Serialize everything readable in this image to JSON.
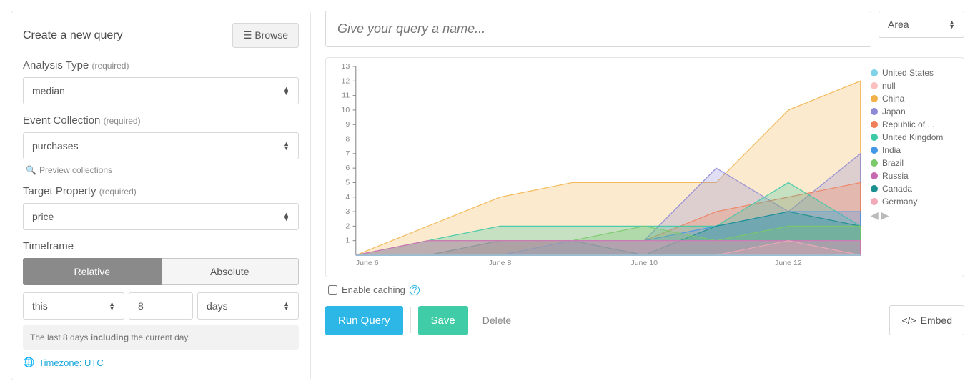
{
  "left": {
    "title": "Create a new query",
    "browse_label": "Browse",
    "analysis_label": "Analysis Type",
    "required": "(required)",
    "analysis_value": "median",
    "event_label": "Event Collection",
    "event_value": "purchases",
    "preview_label": "Preview collections",
    "target_label": "Target Property",
    "target_value": "price",
    "timeframe_label": "Timeframe",
    "tab_relative": "Relative",
    "tab_absolute": "Absolute",
    "rel_qualifier": "this",
    "rel_amount": "8",
    "rel_unit": "days",
    "tf_desc_pre": "The last 8 days ",
    "tf_desc_bold": "including",
    "tf_desc_post": " the current day.",
    "tz_label": "Timezone: UTC"
  },
  "right": {
    "query_name_placeholder": "Give your query a name...",
    "chart_type": "Area",
    "enable_caching": "Enable caching",
    "run_query": "Run Query",
    "save": "Save",
    "delete": "Delete",
    "embed": "Embed"
  },
  "legend": [
    {
      "name": "United States",
      "color": "#7fd3e8"
    },
    {
      "name": "null",
      "color": "#fcbfc1"
    },
    {
      "name": "China",
      "color": "#f2b24a"
    },
    {
      "name": "Japan",
      "color": "#8e8ad6"
    },
    {
      "name": "Republic of ...",
      "color": "#f07e5a"
    },
    {
      "name": "United Kingdom",
      "color": "#3bc9a6"
    },
    {
      "name": "India",
      "color": "#4496e8"
    },
    {
      "name": "Brazil",
      "color": "#7ac96b"
    },
    {
      "name": "Russia",
      "color": "#c66bb3"
    },
    {
      "name": "Canada",
      "color": "#1a8f8f"
    },
    {
      "name": "Germany",
      "color": "#f2a9b8"
    }
  ],
  "chart_data": {
    "type": "area",
    "x": [
      "June 6",
      "June 7",
      "June 8",
      "June 9",
      "June 10",
      "June 11",
      "June 12",
      "June 13"
    ],
    "ylim": [
      0,
      13
    ],
    "yticks": [
      1,
      2,
      3,
      4,
      5,
      6,
      7,
      8,
      9,
      10,
      11,
      12,
      13
    ],
    "xtick_labels": [
      "June 6",
      "June 8",
      "June 10",
      "June 12"
    ],
    "series": [
      {
        "name": "United States",
        "color": "#7fd3e8",
        "values": [
          0,
          0,
          0,
          0,
          0,
          0,
          0,
          0
        ]
      },
      {
        "name": "null",
        "color": "#fcbfc1",
        "values": [
          0,
          1,
          1,
          1,
          1,
          1,
          1,
          1
        ]
      },
      {
        "name": "China",
        "color": "#f2b24a",
        "values": [
          0,
          2,
          4,
          5,
          5,
          5,
          10,
          12
        ]
      },
      {
        "name": "Japan",
        "color": "#8e8ad6",
        "values": [
          0,
          1,
          1,
          1,
          1,
          6,
          3,
          7
        ]
      },
      {
        "name": "Republic of ...",
        "color": "#f07e5a",
        "values": [
          0,
          0,
          1,
          1,
          1,
          3,
          4,
          5
        ]
      },
      {
        "name": "United Kingdom",
        "color": "#3bc9a6",
        "values": [
          0,
          1,
          2,
          2,
          2,
          2,
          5,
          2
        ]
      },
      {
        "name": "India",
        "color": "#4496e8",
        "values": [
          0,
          0,
          0,
          1,
          1,
          2,
          3,
          3
        ]
      },
      {
        "name": "Brazil",
        "color": "#7ac96b",
        "values": [
          0,
          1,
          1,
          1,
          2,
          1,
          2,
          2
        ]
      },
      {
        "name": "Russia",
        "color": "#c66bb3",
        "values": [
          0,
          1,
          1,
          1,
          1,
          1,
          1,
          1
        ]
      },
      {
        "name": "Canada",
        "color": "#1a8f8f",
        "values": [
          0,
          0,
          1,
          1,
          0,
          2,
          3,
          2
        ]
      },
      {
        "name": "Germany",
        "color": "#f2a9b8",
        "values": [
          0,
          0,
          0,
          0,
          0,
          0,
          1,
          0
        ]
      }
    ]
  }
}
